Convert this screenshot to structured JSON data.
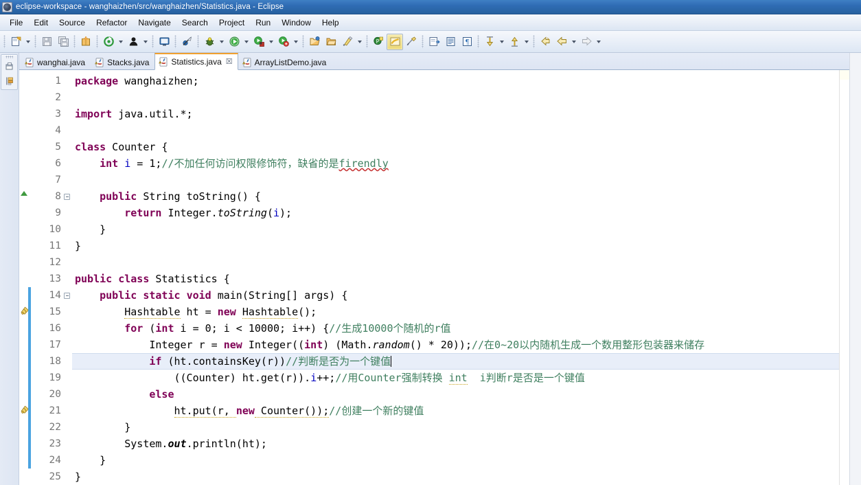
{
  "window": {
    "title": "eclipse-workspace - wanghaizhen/src/wanghaizhen/Statistics.java - Eclipse",
    "app_icon": "eclipse-icon"
  },
  "menubar": {
    "items": [
      {
        "label": "File",
        "name": "menu-file"
      },
      {
        "label": "Edit",
        "name": "menu-edit"
      },
      {
        "label": "Source",
        "name": "menu-source"
      },
      {
        "label": "Refactor",
        "name": "menu-refactor"
      },
      {
        "label": "Navigate",
        "name": "menu-navigate"
      },
      {
        "label": "Search",
        "name": "menu-search"
      },
      {
        "label": "Project",
        "name": "menu-project"
      },
      {
        "label": "Run",
        "name": "menu-run"
      },
      {
        "label": "Window",
        "name": "menu-window"
      },
      {
        "label": "Help",
        "name": "menu-help"
      }
    ]
  },
  "toolbar": {
    "buttons": [
      {
        "icon": "new-wizard-icon",
        "dropdown": true
      },
      {
        "icon": "save-icon",
        "dropdown": false
      },
      {
        "icon": "save-all-icon",
        "dropdown": false
      },
      {
        "icon": "new-java-package-icon",
        "dropdown": false
      },
      {
        "icon": "build-all-icon",
        "dropdown": true
      },
      {
        "icon": "debug-person-icon",
        "dropdown": true
      },
      {
        "icon": "console-icon",
        "dropdown": false
      },
      {
        "icon": "skip-breakpoints-icon",
        "dropdown": false
      },
      {
        "icon": "debug-bug-icon",
        "dropdown": true
      },
      {
        "icon": "run-icon",
        "dropdown": true
      },
      {
        "icon": "run-coverage-icon",
        "dropdown": true
      },
      {
        "icon": "run-external-tools-icon",
        "dropdown": true
      },
      {
        "icon": "open-type-icon",
        "dropdown": false
      },
      {
        "icon": "open-task-icon",
        "dropdown": false
      },
      {
        "icon": "search-icon",
        "dropdown": true
      },
      {
        "icon": "new-annotation-icon",
        "dropdown": false
      },
      {
        "icon": "toggle-mark-occurrences-icon",
        "dropdown": false,
        "pressed": true
      },
      {
        "icon": "link-editor-icon",
        "dropdown": false
      },
      {
        "icon": "next-annotation-icon",
        "dropdown": false
      },
      {
        "icon": "show-whitespace-icon",
        "dropdown": false
      },
      {
        "icon": "pilcrow-icon",
        "dropdown": false
      },
      {
        "icon": "previous-edit-icon",
        "dropdown": true
      },
      {
        "icon": "next-edit-icon",
        "dropdown": true
      },
      {
        "icon": "back-history-icon",
        "dropdown": false
      },
      {
        "icon": "back-arrow-icon",
        "dropdown": true
      },
      {
        "icon": "forward-arrow-icon",
        "dropdown": true
      }
    ]
  },
  "leftbar": {
    "buttons": [
      {
        "icon": "restore-perspective-icon",
        "name": "restore-perspective-button"
      },
      {
        "icon": "package-explorer-icon",
        "name": "package-explorer-fastview-button"
      }
    ]
  },
  "tabs": [
    {
      "label": "wanghai.java",
      "active": false,
      "closable": false,
      "icon": "java-file-warning-icon"
    },
    {
      "label": "Stacks.java",
      "active": false,
      "closable": false,
      "icon": "java-file-warning-icon"
    },
    {
      "label": "Statistics.java",
      "active": true,
      "closable": true,
      "close_glyph": "☒",
      "icon": "java-file-warning-icon"
    },
    {
      "label": "ArrayListDemo.java",
      "active": false,
      "closable": false,
      "icon": "java-file-warning-icon"
    }
  ],
  "editor": {
    "current_line": 18,
    "colors": {
      "keyword": "#7f0055",
      "comment": "#3f7f5f",
      "string": "#2a00ff",
      "field": "#0000c0",
      "current_line_bg": "#e8eef9",
      "change_bar": "#4aa3e0",
      "spell_error": "#c43030"
    },
    "lines": [
      {
        "n": "1",
        "indent": 0,
        "marker": "",
        "fold": false,
        "change": false,
        "tokens": [
          {
            "t": "package",
            "c": "kw"
          },
          {
            "t": " wanghaizhen;",
            "c": "plain"
          }
        ]
      },
      {
        "n": "2",
        "indent": 0,
        "marker": "",
        "fold": false,
        "change": false,
        "tokens": []
      },
      {
        "n": "3",
        "indent": 0,
        "marker": "",
        "fold": false,
        "change": false,
        "tokens": [
          {
            "t": "import",
            "c": "kw"
          },
          {
            "t": " java.util.*;",
            "c": "plain"
          }
        ]
      },
      {
        "n": "4",
        "indent": 0,
        "marker": "",
        "fold": false,
        "change": false,
        "tokens": []
      },
      {
        "n": "5",
        "indent": 0,
        "marker": "",
        "fold": false,
        "change": false,
        "tokens": [
          {
            "t": "class",
            "c": "kw"
          },
          {
            "t": " Counter {",
            "c": "plain"
          }
        ]
      },
      {
        "n": "6",
        "indent": 0,
        "marker": "",
        "fold": false,
        "change": false,
        "tokens": [
          {
            "t": "    ",
            "c": "plain"
          },
          {
            "t": "int",
            "c": "kw"
          },
          {
            "t": " ",
            "c": "plain"
          },
          {
            "t": "i",
            "c": "fld"
          },
          {
            "t": " = ",
            "c": "plain"
          },
          {
            "t": "1",
            "c": "plain"
          },
          {
            "t": ";",
            "c": "plain"
          },
          {
            "t": "//不加任何访问权限修饰符，缺省的是",
            "c": "cmt"
          },
          {
            "t": "firendly",
            "c": "cmt spell"
          }
        ]
      },
      {
        "n": "7",
        "indent": 0,
        "marker": "",
        "fold": false,
        "change": false,
        "tokens": []
      },
      {
        "n": "8",
        "indent": 0,
        "marker": "override",
        "fold": true,
        "change": false,
        "tokens": [
          {
            "t": "    ",
            "c": "plain"
          },
          {
            "t": "public",
            "c": "kw"
          },
          {
            "t": " String ",
            "c": "plain"
          },
          {
            "t": "toString",
            "c": "plain"
          },
          {
            "t": "() {",
            "c": "plain"
          }
        ]
      },
      {
        "n": "9",
        "indent": 0,
        "marker": "",
        "fold": false,
        "change": false,
        "tokens": [
          {
            "t": "        ",
            "c": "plain"
          },
          {
            "t": "return",
            "c": "kw"
          },
          {
            "t": " Integer.",
            "c": "plain"
          },
          {
            "t": "toString",
            "c": "stc"
          },
          {
            "t": "(",
            "c": "plain"
          },
          {
            "t": "i",
            "c": "fld"
          },
          {
            "t": ");",
            "c": "plain"
          }
        ]
      },
      {
        "n": "10",
        "indent": 0,
        "marker": "",
        "fold": false,
        "change": false,
        "tokens": [
          {
            "t": "    }",
            "c": "plain"
          }
        ]
      },
      {
        "n": "11",
        "indent": 0,
        "marker": "",
        "fold": false,
        "change": false,
        "tokens": [
          {
            "t": "}",
            "c": "plain"
          }
        ]
      },
      {
        "n": "12",
        "indent": 0,
        "marker": "",
        "fold": false,
        "change": false,
        "tokens": []
      },
      {
        "n": "13",
        "indent": 0,
        "marker": "",
        "fold": false,
        "change": false,
        "tokens": [
          {
            "t": "public",
            "c": "kw"
          },
          {
            "t": " ",
            "c": "plain"
          },
          {
            "t": "class",
            "c": "kw"
          },
          {
            "t": " Statistics {",
            "c": "plain"
          }
        ]
      },
      {
        "n": "14",
        "indent": 0,
        "marker": "",
        "fold": true,
        "change": true,
        "tokens": [
          {
            "t": "    ",
            "c": "plain"
          },
          {
            "t": "public",
            "c": "kw"
          },
          {
            "t": " ",
            "c": "plain"
          },
          {
            "t": "static",
            "c": "kw"
          },
          {
            "t": " ",
            "c": "plain"
          },
          {
            "t": "void",
            "c": "kw"
          },
          {
            "t": " main(String[] args) {",
            "c": "plain"
          }
        ]
      },
      {
        "n": "15",
        "indent": 0,
        "marker": "warning",
        "fold": false,
        "change": true,
        "tokens": [
          {
            "t": "        ",
            "c": "plain"
          },
          {
            "t": "Hashtable",
            "c": "plain warnline"
          },
          {
            "t": " ht = ",
            "c": "plain"
          },
          {
            "t": "new",
            "c": "kw"
          },
          {
            "t": " ",
            "c": "plain"
          },
          {
            "t": "Hashtable",
            "c": "plain warnline"
          },
          {
            "t": "();",
            "c": "plain"
          }
        ]
      },
      {
        "n": "16",
        "indent": 0,
        "marker": "",
        "fold": false,
        "change": true,
        "tokens": [
          {
            "t": "        ",
            "c": "plain"
          },
          {
            "t": "for",
            "c": "kw"
          },
          {
            "t": " (",
            "c": "plain"
          },
          {
            "t": "int",
            "c": "kw"
          },
          {
            "t": " i = ",
            "c": "plain"
          },
          {
            "t": "0",
            "c": "plain"
          },
          {
            "t": "; i < ",
            "c": "plain"
          },
          {
            "t": "10000",
            "c": "plain"
          },
          {
            "t": "; i++) {",
            "c": "plain"
          },
          {
            "t": "//生成10000个随机的r值",
            "c": "cmt"
          }
        ]
      },
      {
        "n": "17",
        "indent": 0,
        "marker": "",
        "fold": false,
        "change": true,
        "tokens": [
          {
            "t": "            ",
            "c": "plain"
          },
          {
            "t": "Integer r = ",
            "c": "plain"
          },
          {
            "t": "new",
            "c": "kw"
          },
          {
            "t": " Integer((",
            "c": "plain"
          },
          {
            "t": "int",
            "c": "kw"
          },
          {
            "t": ") (Math.",
            "c": "plain"
          },
          {
            "t": "random",
            "c": "stc"
          },
          {
            "t": "() * ",
            "c": "plain"
          },
          {
            "t": "20",
            "c": "plain"
          },
          {
            "t": "));",
            "c": "plain"
          },
          {
            "t": "//在0~20以内随机生成一个数用整形包装器来储存",
            "c": "cmt"
          }
        ]
      },
      {
        "n": "18",
        "indent": 0,
        "marker": "",
        "fold": false,
        "change": true,
        "current": true,
        "tokens": [
          {
            "t": "            ",
            "c": "plain"
          },
          {
            "t": "if",
            "c": "kw"
          },
          {
            "t": " (ht.containsKey(r))",
            "c": "plain"
          },
          {
            "t": "//判断是否为一个键值",
            "c": "cmt"
          }
        ]
      },
      {
        "n": "19",
        "indent": 0,
        "marker": "",
        "fold": false,
        "change": true,
        "tokens": [
          {
            "t": "                ",
            "c": "plain"
          },
          {
            "t": "((Counter) ht.get(r)).",
            "c": "plain"
          },
          {
            "t": "i",
            "c": "fld"
          },
          {
            "t": "++;",
            "c": "plain"
          },
          {
            "t": "//用Counter强制转换 ",
            "c": "cmt"
          },
          {
            "t": "int",
            "c": "cmt warnline"
          },
          {
            "t": "  i判断r是否是一个键值",
            "c": "cmt"
          }
        ]
      },
      {
        "n": "20",
        "indent": 0,
        "marker": "",
        "fold": false,
        "change": true,
        "tokens": [
          {
            "t": "            ",
            "c": "plain"
          },
          {
            "t": "else",
            "c": "kw"
          }
        ]
      },
      {
        "n": "21",
        "indent": 0,
        "marker": "warning",
        "fold": false,
        "change": true,
        "tokens": [
          {
            "t": "                ",
            "c": "plain"
          },
          {
            "t": "ht.put(r, ",
            "c": "plain warnline"
          },
          {
            "t": "new",
            "c": "kw"
          },
          {
            "t": " Counter());",
            "c": "plain warnline"
          },
          {
            "t": "//创建一个新的键值",
            "c": "cmt"
          }
        ]
      },
      {
        "n": "22",
        "indent": 0,
        "marker": "",
        "fold": false,
        "change": true,
        "tokens": [
          {
            "t": "        }",
            "c": "plain"
          }
        ]
      },
      {
        "n": "23",
        "indent": 0,
        "marker": "",
        "fold": false,
        "change": true,
        "tokens": [
          {
            "t": "        System.",
            "c": "plain"
          },
          {
            "t": "out",
            "c": "stc",
            "bold": true
          },
          {
            "t": ".println(ht);",
            "c": "plain"
          }
        ]
      },
      {
        "n": "24",
        "indent": 0,
        "marker": "",
        "fold": false,
        "change": true,
        "tokens": [
          {
            "t": "    }",
            "c": "plain"
          }
        ]
      },
      {
        "n": "25",
        "indent": 0,
        "marker": "",
        "fold": false,
        "change": false,
        "tokens": [
          {
            "t": "}",
            "c": "plain"
          }
        ]
      }
    ]
  }
}
